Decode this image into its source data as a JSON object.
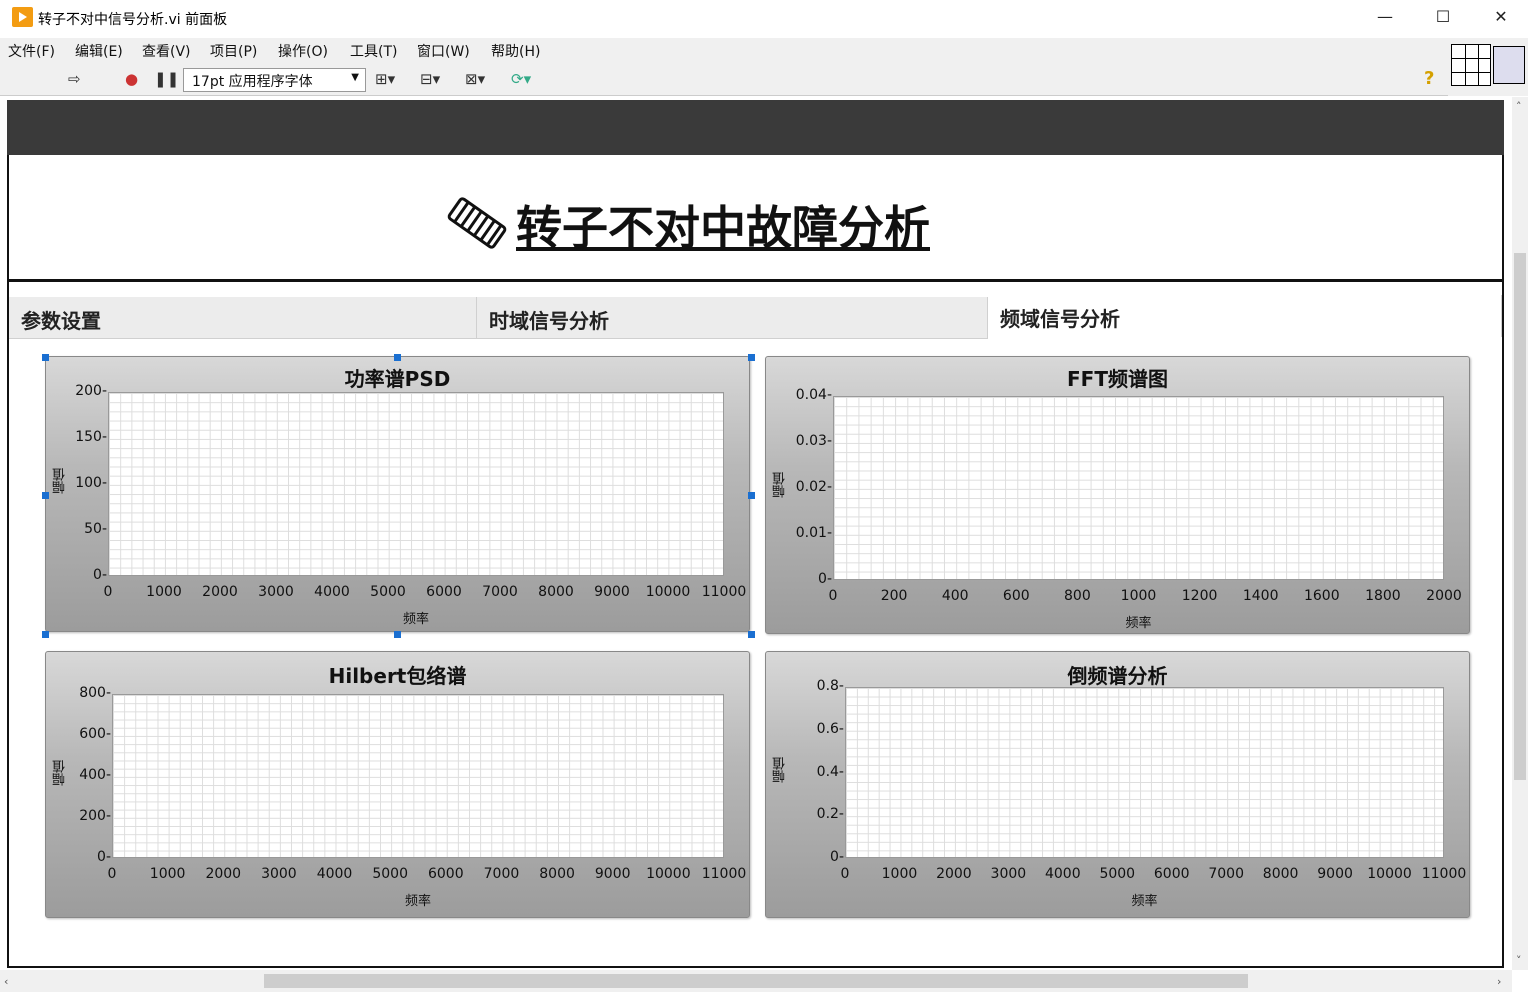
{
  "window": {
    "title": "转子不对中信号分析.vi 前面板",
    "minimize": "—",
    "maximize": "☐",
    "close": "✕"
  },
  "menu": [
    "文件(F)",
    "编辑(E)",
    "查看(V)",
    "项目(P)",
    "操作(O)",
    "工具(T)",
    "窗口(W)",
    "帮助(H)"
  ],
  "toolbar": {
    "font": "17pt 应用程序字体",
    "help": "?"
  },
  "page": {
    "title": "转子不对中故障分析"
  },
  "tabs": [
    "参数设置",
    "时域信号分析",
    "频域信号分析"
  ],
  "active_tab": 2,
  "chart_data": [
    {
      "type": "line",
      "title": "功率谱PSD",
      "xlabel": "频率",
      "ylabel": "幅值",
      "xlim": [
        0,
        11000
      ],
      "ylim": [
        0,
        200
      ],
      "xticks": [
        "0",
        "1000",
        "2000",
        "3000",
        "4000",
        "5000",
        "6000",
        "7000",
        "8000",
        "9000",
        "10000",
        "11000"
      ],
      "yticks": [
        "200",
        "150",
        "100",
        "50",
        "0"
      ],
      "series": []
    },
    {
      "type": "line",
      "title": "FFT频谱图",
      "xlabel": "频率",
      "ylabel": "幅值",
      "xlim": [
        0,
        2000
      ],
      "ylim": [
        0,
        0.04
      ],
      "xticks": [
        "0",
        "200",
        "400",
        "600",
        "800",
        "1000",
        "1200",
        "1400",
        "1600",
        "1800",
        "2000"
      ],
      "yticks": [
        "0.04",
        "0.03",
        "0.02",
        "0.01",
        "0"
      ],
      "series": []
    },
    {
      "type": "line",
      "title": "Hilbert包络谱",
      "xlabel": "频率",
      "ylabel": "幅值",
      "xlim": [
        0,
        11000
      ],
      "ylim": [
        0,
        800
      ],
      "xticks": [
        "0",
        "1000",
        "2000",
        "3000",
        "4000",
        "5000",
        "6000",
        "7000",
        "8000",
        "9000",
        "10000",
        "11000"
      ],
      "yticks": [
        "800",
        "600",
        "400",
        "200",
        "0"
      ],
      "series": []
    },
    {
      "type": "line",
      "title": "倒频谱分析",
      "xlabel": "频率",
      "ylabel": "幅值",
      "xlim": [
        0,
        11000
      ],
      "ylim": [
        0,
        0.8
      ],
      "xticks": [
        "0",
        "1000",
        "2000",
        "3000",
        "4000",
        "5000",
        "6000",
        "7000",
        "8000",
        "9000",
        "10000",
        "11000"
      ],
      "yticks": [
        "0.8",
        "0.6",
        "0.4",
        "0.2",
        "0"
      ],
      "series": []
    }
  ]
}
